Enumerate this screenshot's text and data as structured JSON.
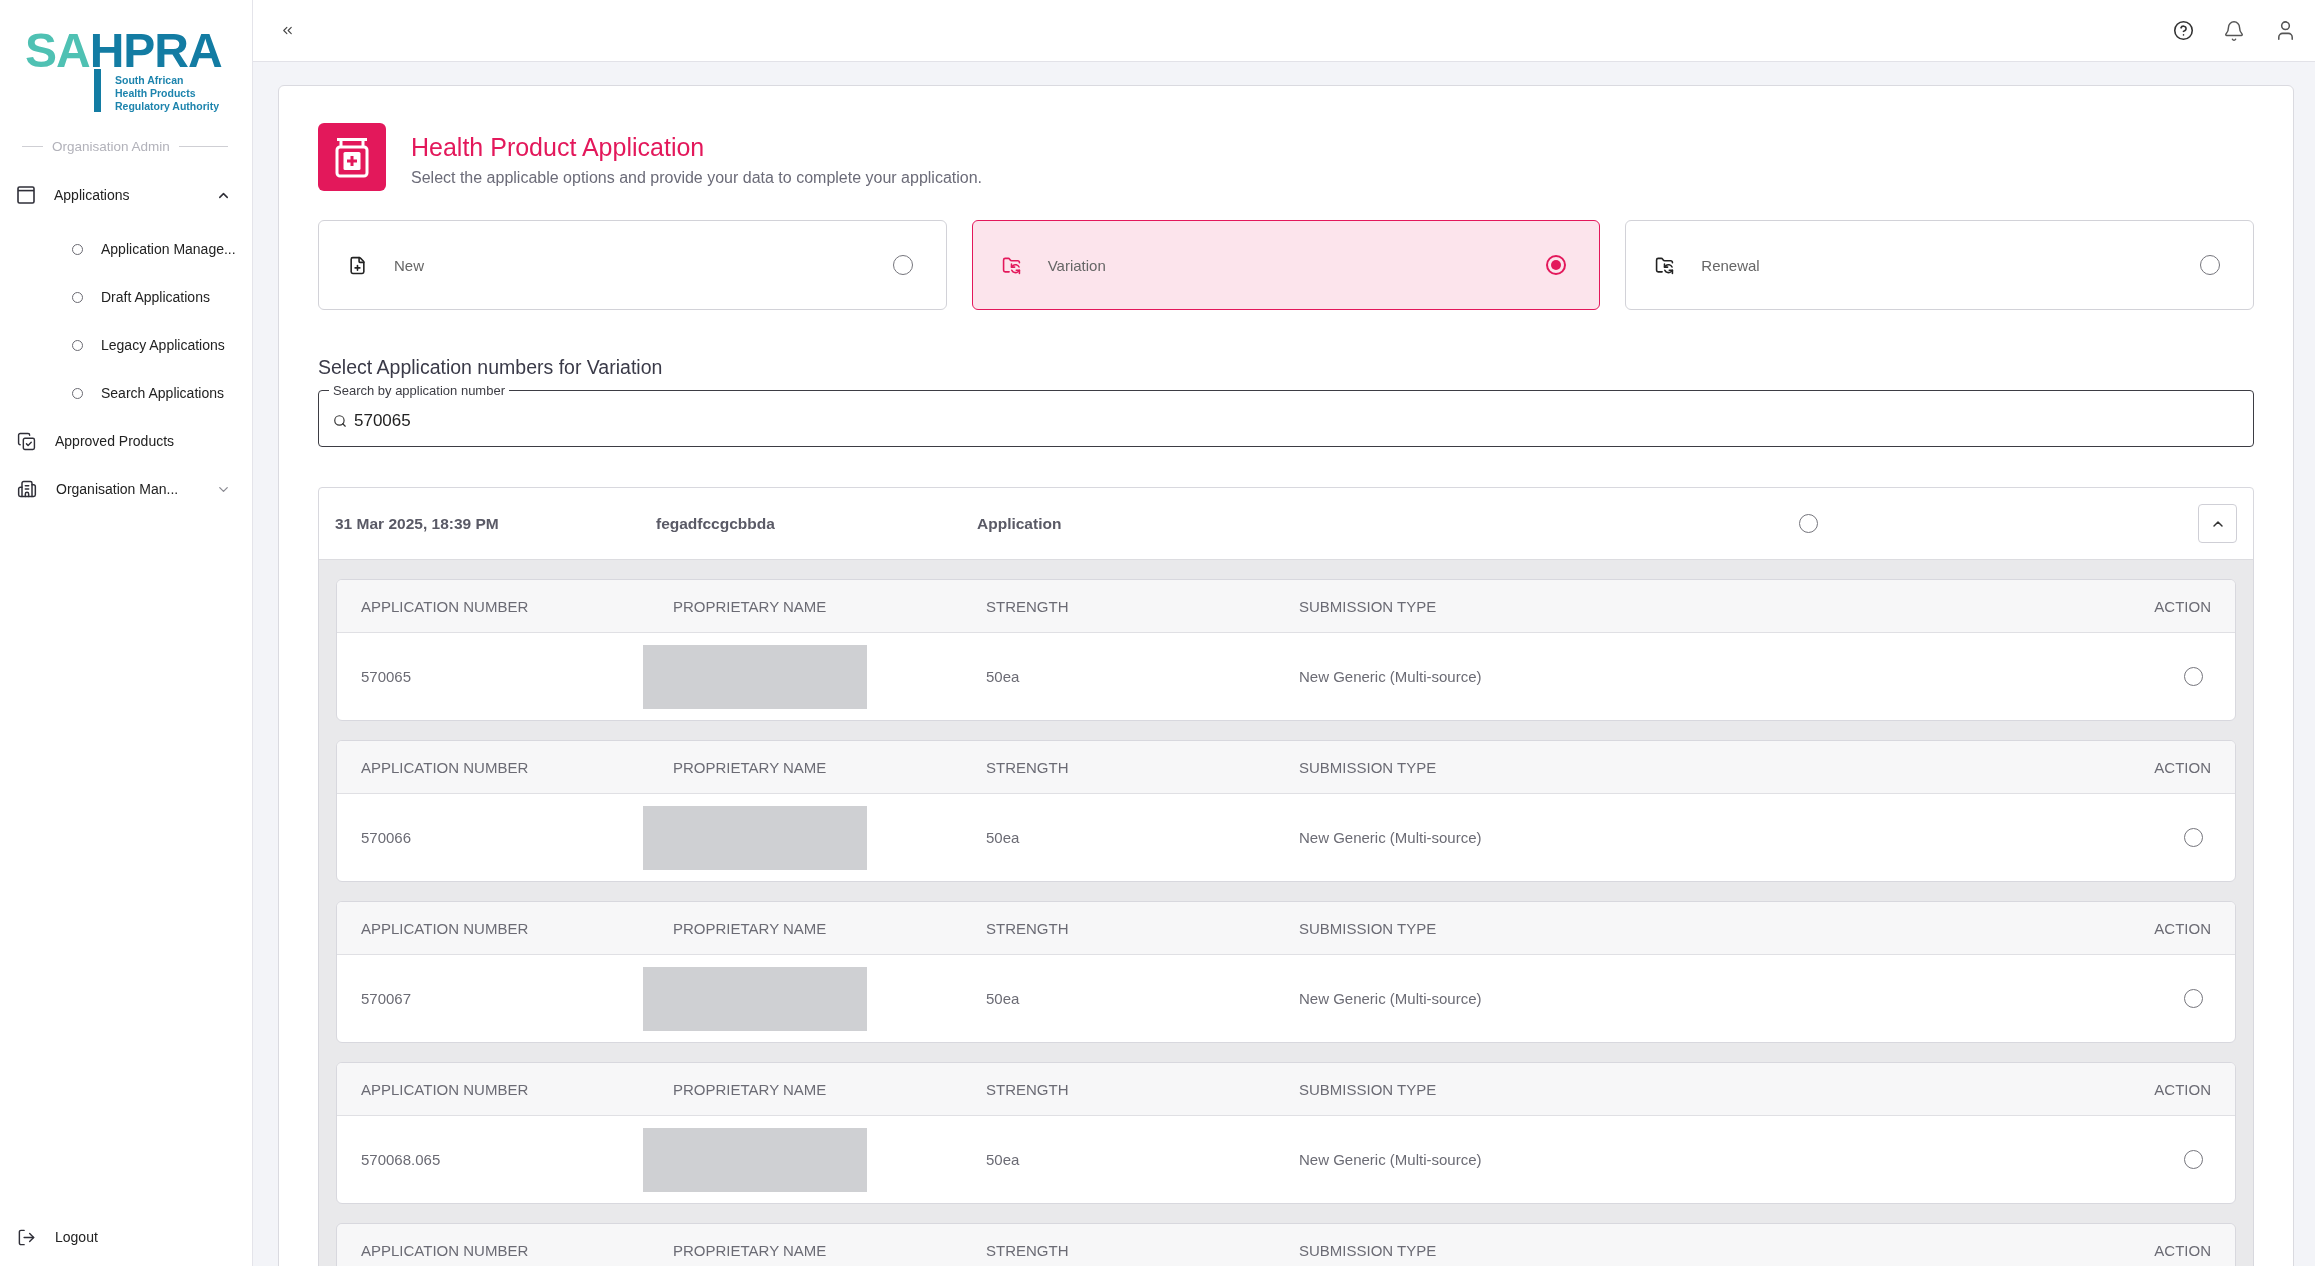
{
  "sidebar": {
    "logo": {
      "wordmark": [
        "SA",
        "HPRA"
      ],
      "tagline": [
        "South African",
        "Health Products",
        "Regulatory Authority"
      ]
    },
    "section_label": "Organisation Admin",
    "items": [
      {
        "label": "Applications",
        "selected": false,
        "expanded": true,
        "children": [
          {
            "label": "Application Manage...",
            "selected": false
          },
          {
            "label": "Draft Applications",
            "selected": false
          },
          {
            "label": "Legacy Applications",
            "selected": false
          },
          {
            "label": "Search Applications",
            "selected": false
          }
        ]
      },
      {
        "label": "Approved Products",
        "selected": false
      },
      {
        "label": "Organisation Man...",
        "selected": false,
        "expanded": false
      }
    ],
    "logout": "Logout"
  },
  "header": {
    "title": "Health Product Application",
    "subtitle": "Select the applicable options and provide your data to complete your application."
  },
  "options": [
    {
      "label": "New",
      "selected": false
    },
    {
      "label": "Variation",
      "selected": true
    },
    {
      "label": "Renewal",
      "selected": false
    }
  ],
  "search": {
    "prompt": "Select Application numbers for Variation",
    "label": "Search by application number",
    "value": "570065"
  },
  "results": [
    {
      "date": "31 Mar 2025, 18:39 PM",
      "reference": "fegadfccgcbbda",
      "type": "Application",
      "selected": false,
      "expanded": true,
      "items": [
        {
          "columns": [
            "APPLICATION NUMBER",
            "PROPRIETARY NAME",
            "STRENGTH",
            "SUBMISSION TYPE",
            "ACTION"
          ],
          "row": {
            "application_number": "570065",
            "strength": "50ea",
            "submission_type": "New Generic (Multi-source)",
            "selected": false
          }
        },
        {
          "columns": [
            "APPLICATION NUMBER",
            "PROPRIETARY NAME",
            "STRENGTH",
            "SUBMISSION TYPE",
            "ACTION"
          ],
          "row": {
            "application_number": "570066",
            "strength": "50ea",
            "submission_type": "New Generic (Multi-source)",
            "selected": false
          }
        },
        {
          "columns": [
            "APPLICATION NUMBER",
            "PROPRIETARY NAME",
            "STRENGTH",
            "SUBMISSION TYPE",
            "ACTION"
          ],
          "row": {
            "application_number": "570067",
            "strength": "50ea",
            "submission_type": "New Generic (Multi-source)",
            "selected": false
          }
        },
        {
          "columns": [
            "APPLICATION NUMBER",
            "PROPRIETARY NAME",
            "STRENGTH",
            "SUBMISSION TYPE",
            "ACTION"
          ],
          "row": {
            "application_number": "570068.065",
            "strength": "50ea",
            "submission_type": "New Generic (Multi-source)",
            "selected": false
          }
        },
        {
          "columns": [
            "APPLICATION NUMBER",
            "PROPRIETARY NAME",
            "STRENGTH",
            "SUBMISSION TYPE",
            "ACTION"
          ]
        }
      ]
    }
  ]
}
